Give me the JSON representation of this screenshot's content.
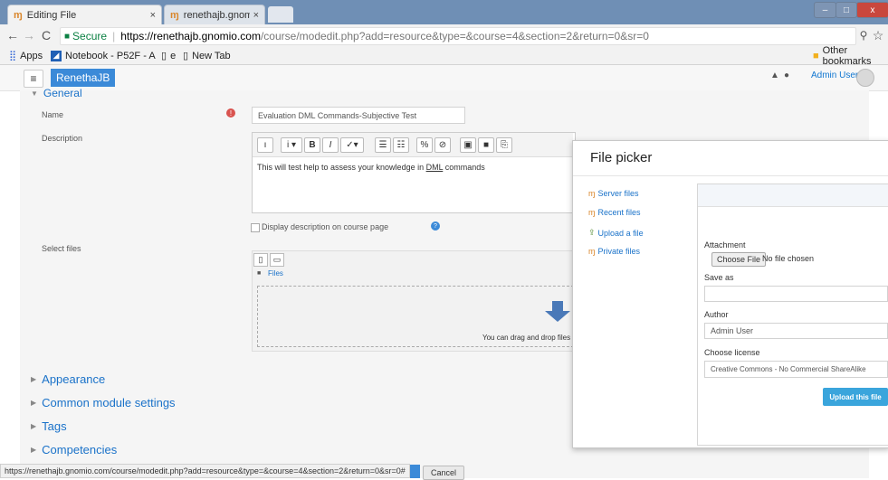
{
  "browser": {
    "tabs": [
      {
        "title": "Editing File",
        "close": "×"
      },
      {
        "title": "renethajb.gnomio.com",
        "close": "×"
      }
    ],
    "nav": {
      "back": "←",
      "forward": "→",
      "reload": "C"
    },
    "address": {
      "secure_label": "Secure",
      "host": "https://renethajb.gnomio.com",
      "path": "/course/modedit.php?add=resource&type=&course=4&section=2&return=0&sr=0"
    },
    "toolbar_icons": {
      "zoom": "⚲",
      "star": "☆",
      "menu": "⋮"
    },
    "bookmarks": [
      {
        "label": "Apps"
      },
      {
        "label": "Notebook - P52F - A"
      },
      {
        "label": "e"
      },
      {
        "label": "New Tab"
      }
    ],
    "other_bookmarks": "Other bookmarks",
    "window_controls": {
      "minimize": "–",
      "maximize": "□",
      "close": "x"
    }
  },
  "navbar": {
    "menu_icon": "≡",
    "brand": "RenethaJB",
    "user": "Admin User"
  },
  "form": {
    "section_general": "General",
    "name_label": "Name",
    "name_value": "Evaluation DML Commands-Subjective Test",
    "description_label": "Description",
    "editor_buttons": [
      "ı",
      "i ▾",
      "B",
      "I",
      "✓▾",
      "☰",
      "☷",
      "%",
      "⊘",
      "▣",
      "■",
      "⎘"
    ],
    "description_pre": "This will test help to assess your knowledge in ",
    "description_dml": "DML",
    "description_post": " commands",
    "display_desc": "Display description on course page",
    "select_files_label": "Select files",
    "files_folder": "Files",
    "drop_text": "You can drag and drop files",
    "sections": [
      "Appearance",
      "Common module settings",
      "Tags",
      "Competencies"
    ],
    "cancel": "Cancel"
  },
  "picker": {
    "title": "File picker",
    "repos": [
      "Server files",
      "Recent files",
      "Upload a file",
      "Private files"
    ],
    "attachment_label": "Attachment",
    "choose_file": "Choose File",
    "no_file": "No file chosen",
    "save_as_label": "Save as",
    "save_as_value": "",
    "author_label": "Author",
    "author_value": "Admin User",
    "license_label": "Choose license",
    "license_value": "Creative Commons - No Commercial ShareAlike",
    "upload_button": "Upload this file"
  },
  "statusbar": "https://renethajb.gnomio.com/course/modedit.php?add=resource&type=&course=4&section=2&return=0&sr=0#"
}
